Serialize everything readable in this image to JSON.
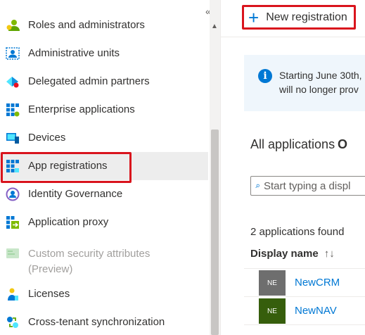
{
  "nav": {
    "collapse_glyph": "«",
    "items": [
      {
        "label": "Roles and administrators",
        "icon": "roles-icon"
      },
      {
        "label": "Administrative units",
        "icon": "admin-units-icon"
      },
      {
        "label": "Delegated admin partners",
        "icon": "delegated-partners-icon"
      },
      {
        "label": "Enterprise applications",
        "icon": "enterprise-apps-icon"
      },
      {
        "label": "Devices",
        "icon": "devices-icon"
      },
      {
        "label": "App registrations",
        "icon": "app-registrations-icon",
        "selected": true
      },
      {
        "label": "Identity Governance",
        "icon": "identity-governance-icon"
      },
      {
        "label": "Application proxy",
        "icon": "application-proxy-icon"
      },
      {
        "label": "Custom security attributes (Preview)",
        "line1": "Custom security attributes",
        "line2": "(Preview)",
        "icon": "custom-security-attributes-icon",
        "disabled": true
      },
      {
        "label": "Licenses",
        "icon": "licenses-icon"
      },
      {
        "label": "Cross-tenant synchronization",
        "icon": "cross-tenant-sync-icon"
      }
    ]
  },
  "toolbar": {
    "new_registration_label": "New registration"
  },
  "banner": {
    "line1": "Starting June 30th,",
    "line2": "will no longer prov"
  },
  "tabs": {
    "all": "All applications",
    "other": "O"
  },
  "search": {
    "placeholder": "Start typing a displ"
  },
  "list": {
    "count_text": "2 applications found",
    "column_header": "Display name",
    "sort_glyph": "↑↓",
    "apps": [
      {
        "initials": "NE",
        "name": "NewCRM",
        "avatar_color": "#6e6e6e"
      },
      {
        "initials": "NE",
        "name": "NewNAV",
        "avatar_color": "#365e0c"
      }
    ]
  },
  "colors": {
    "accent": "#0078d4",
    "highlight_border": "#d9141d",
    "selected_bg": "#ededed",
    "banner_bg": "#eff6fc"
  }
}
